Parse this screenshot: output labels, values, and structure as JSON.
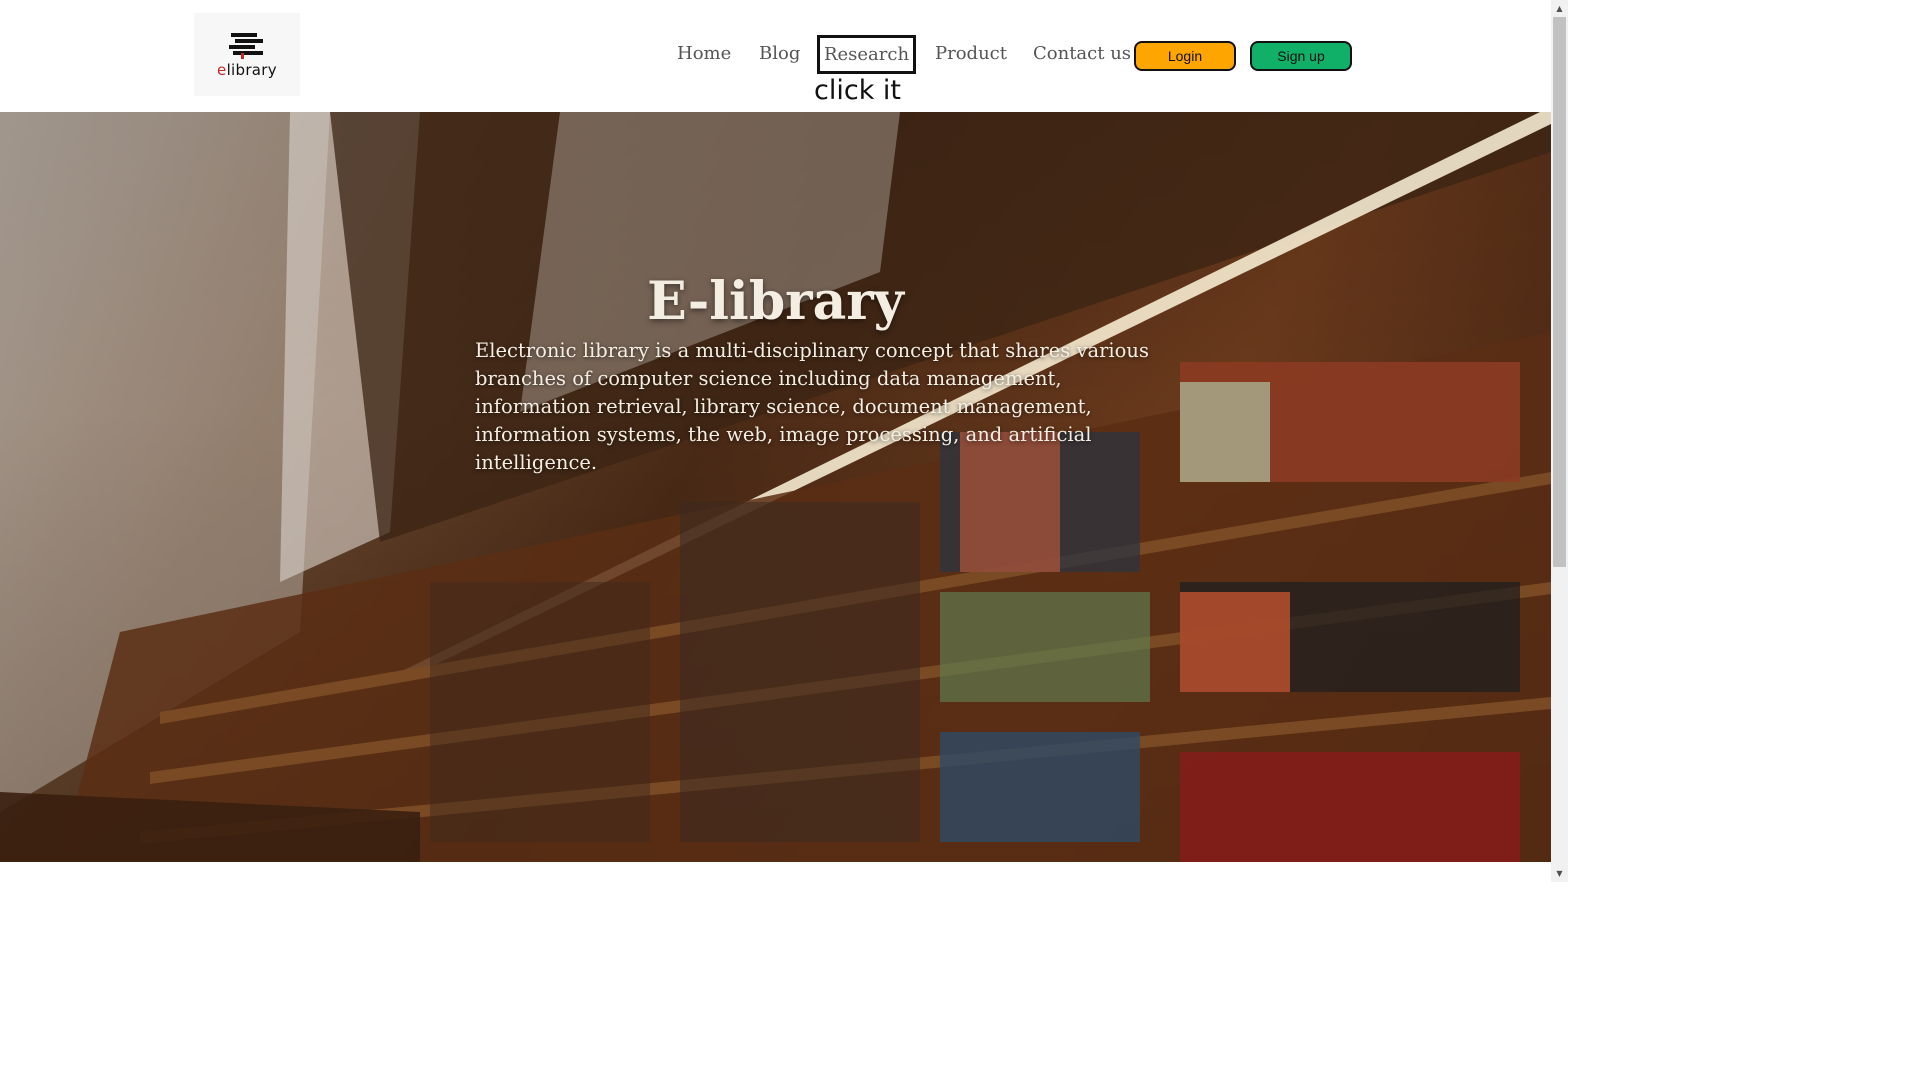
{
  "logo": {
    "text_prefix": "e",
    "text_rest": "library"
  },
  "nav": {
    "home": "Home",
    "blog": "Blog",
    "research": "Research",
    "product": "Product",
    "contact": "Contact us"
  },
  "hint": "click it",
  "buttons": {
    "login": "Login",
    "signup": "Sign up"
  },
  "hero": {
    "title": "E-library",
    "description": "Electronic library is a multi-disciplinary concept that shares various branches of computer science including data management, information retrieval, library science, document management, information systems, the web, image processing, and artificial intelligence."
  },
  "colors": {
    "login_button": "#ffa500",
    "signup_button": "#11b068",
    "highlight_border": "#111111"
  },
  "scrollbar": {
    "up_icon": "triangle-up",
    "down_icon": "triangle-down"
  }
}
